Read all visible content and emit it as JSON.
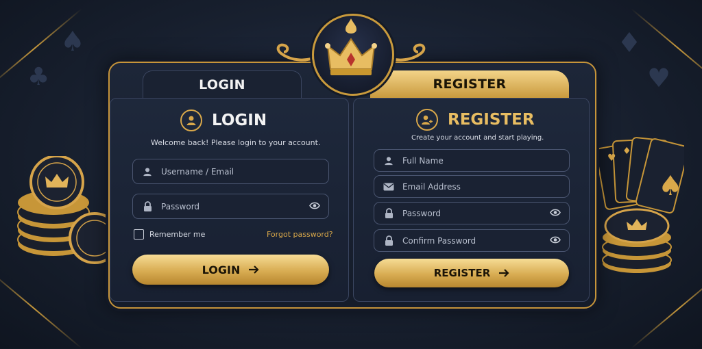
{
  "tabs": {
    "login": "LOGIN",
    "register": "REGISTER"
  },
  "login": {
    "title": "LOGIN",
    "subtitle": "Welcome back! Please login to your account.",
    "username_placeholder": "Username / Email",
    "password_placeholder": "Password",
    "remember_label": "Remember me",
    "forgot_label": "Forgot password?",
    "button_label": "LOGIN"
  },
  "register": {
    "title": "REGISTER",
    "subtitle": "Create your account and start playing.",
    "fullname_placeholder": "Full Name",
    "email_placeholder": "Email Address",
    "password_placeholder": "Password",
    "confirm_placeholder": "Confirm Password",
    "button_label": "REGISTER"
  },
  "colors": {
    "gold": "#d9a84a",
    "navy": "#18202f",
    "accent_link": "#d9a84a"
  },
  "icons": [
    "crown-icon",
    "user-icon",
    "add-user-icon",
    "lock-icon",
    "eye-icon",
    "mail-icon",
    "arrow-right-icon",
    "spade-icon",
    "club-icon",
    "diamond-icon",
    "heart-icon"
  ]
}
